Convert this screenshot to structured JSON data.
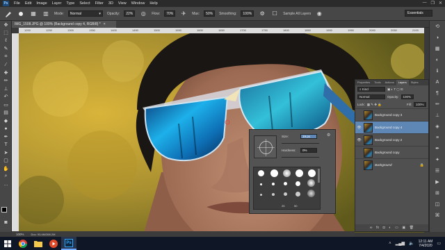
{
  "menubar": {
    "logo": "Ps",
    "items": [
      "File",
      "Edit",
      "Image",
      "Layer",
      "Type",
      "Select",
      "Filter",
      "3D",
      "View",
      "Window",
      "Help"
    ],
    "window_controls": [
      "—",
      "❐",
      "✕"
    ]
  },
  "options": {
    "mode_label": "Mode:",
    "mode_value": "Normal",
    "opacity_label": "Opacity:",
    "opacity_value": "22%",
    "flow_label": "Flow:",
    "flow_value": "70%",
    "max_label": "Max:",
    "max_value": "50%",
    "smoothing_label": "Smoothing:",
    "smoothing_value": "100%",
    "sample_label": "Sample All Layers",
    "workspace": "Essentials"
  },
  "document": {
    "tab_title": "IMG_1508.JPG @ 100% (Background copy 4, RGB/8) *",
    "ruler_ticks": [
      "1200",
      "1250",
      "1300",
      "1350",
      "1400",
      "1450",
      "1500",
      "1550",
      "1600",
      "1650",
      "1700",
      "1750",
      "1800",
      "1850",
      "1900",
      "1950",
      "2000",
      "2050",
      "2100"
    ]
  },
  "status": {
    "zoom": "100%",
    "doc": "Doc: 93.4M/398.2M"
  },
  "brush_popup": {
    "size_label": "Size:",
    "size_value": "19 px",
    "hardness_label": "Hardness:",
    "hardness_value": "0%",
    "grid_labels": [
      "25",
      "50"
    ]
  },
  "layers_panel": {
    "tabs": [
      "Properties",
      "Tools",
      "Actions",
      "Layers",
      "Styles"
    ],
    "active_tab": "Layers",
    "kind": "Kind",
    "blend": "Normal",
    "opacity_label": "Opacity:",
    "opacity_value": "100%",
    "lock_label": "Lock:",
    "fill_label": "Fill:",
    "fill_value": "100%",
    "layers": [
      {
        "name": "Background copy 3",
        "visible": false,
        "selected": false
      },
      {
        "name": "Background copy 4",
        "visible": true,
        "selected": true
      },
      {
        "name": "Background copy 2",
        "visible": true,
        "selected": false
      },
      {
        "name": "Background copy",
        "visible": false,
        "selected": false
      },
      {
        "name": "Background",
        "visible": false,
        "selected": false,
        "locked": true
      }
    ]
  },
  "taskbar": {
    "time": "12:11 AM",
    "date": "7/4/2020",
    "ps_label": "Ps"
  },
  "colors": {
    "selected_layer": "#5f87b6",
    "canvas_bokeh": "#c9a22a",
    "lens_blue": "#19a8e8"
  }
}
